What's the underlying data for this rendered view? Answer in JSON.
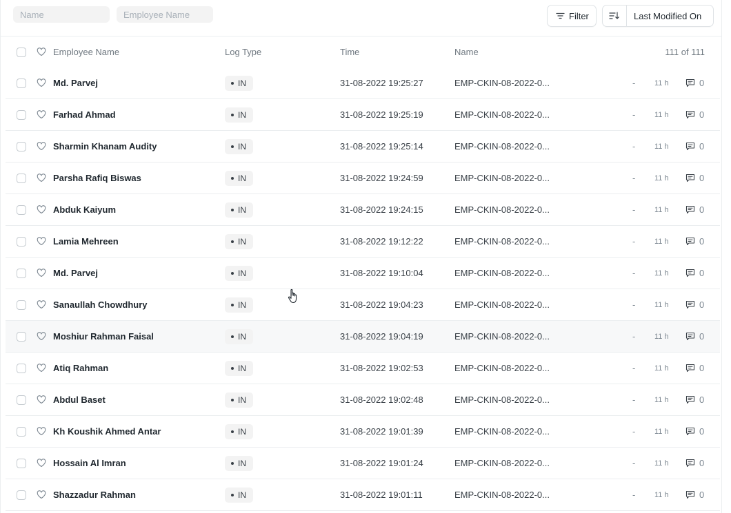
{
  "filters": {
    "name_placeholder": "Name",
    "employee_placeholder": "Employee Name",
    "filter_label": "Filter",
    "sort_label": "Last Modified On"
  },
  "columns": {
    "employee_name": "Employee Name",
    "log_type": "Log Type",
    "time": "Time",
    "name": "Name",
    "count": "111 of 111"
  },
  "rows": [
    {
      "employee": "Md. Parvej",
      "log_type": "IN",
      "time": "31-08-2022 19:25:27",
      "name": "EMP-CKIN-08-2022-0...",
      "dash": "-",
      "modified": "11 h",
      "comments": "0"
    },
    {
      "employee": "Farhad Ahmad",
      "log_type": "IN",
      "time": "31-08-2022 19:25:19",
      "name": "EMP-CKIN-08-2022-0...",
      "dash": "-",
      "modified": "11 h",
      "comments": "0"
    },
    {
      "employee": "Sharmin Khanam Audity",
      "log_type": "IN",
      "time": "31-08-2022 19:25:14",
      "name": "EMP-CKIN-08-2022-0...",
      "dash": "-",
      "modified": "11 h",
      "comments": "0"
    },
    {
      "employee": "Parsha Rafiq Biswas",
      "log_type": "IN",
      "time": "31-08-2022 19:24:59",
      "name": "EMP-CKIN-08-2022-0...",
      "dash": "-",
      "modified": "11 h",
      "comments": "0"
    },
    {
      "employee": "Abduk Kaiyum",
      "log_type": "IN",
      "time": "31-08-2022 19:24:15",
      "name": "EMP-CKIN-08-2022-0...",
      "dash": "-",
      "modified": "11 h",
      "comments": "0"
    },
    {
      "employee": "Lamia Mehreen",
      "log_type": "IN",
      "time": "31-08-2022 19:12:22",
      "name": "EMP-CKIN-08-2022-0...",
      "dash": "-",
      "modified": "11 h",
      "comments": "0"
    },
    {
      "employee": "Md. Parvej",
      "log_type": "IN",
      "time": "31-08-2022 19:10:04",
      "name": "EMP-CKIN-08-2022-0...",
      "dash": "-",
      "modified": "11 h",
      "comments": "0"
    },
    {
      "employee": "Sanaullah Chowdhury",
      "log_type": "IN",
      "time": "31-08-2022 19:04:23",
      "name": "EMP-CKIN-08-2022-0...",
      "dash": "-",
      "modified": "11 h",
      "comments": "0"
    },
    {
      "employee": "Moshiur Rahman Faisal",
      "log_type": "IN",
      "time": "31-08-2022 19:04:19",
      "name": "EMP-CKIN-08-2022-0...",
      "dash": "-",
      "modified": "11 h",
      "comments": "0"
    },
    {
      "employee": "Atiq Rahman",
      "log_type": "IN",
      "time": "31-08-2022 19:02:53",
      "name": "EMP-CKIN-08-2022-0...",
      "dash": "-",
      "modified": "11 h",
      "comments": "0"
    },
    {
      "employee": "Abdul Baset",
      "log_type": "IN",
      "time": "31-08-2022 19:02:48",
      "name": "EMP-CKIN-08-2022-0...",
      "dash": "-",
      "modified": "11 h",
      "comments": "0"
    },
    {
      "employee": "Kh Koushik Ahmed Antar",
      "log_type": "IN",
      "time": "31-08-2022 19:01:39",
      "name": "EMP-CKIN-08-2022-0...",
      "dash": "-",
      "modified": "11 h",
      "comments": "0"
    },
    {
      "employee": "Hossain Al Imran",
      "log_type": "IN",
      "time": "31-08-2022 19:01:24",
      "name": "EMP-CKIN-08-2022-0...",
      "dash": "-",
      "modified": "11 h",
      "comments": "0"
    },
    {
      "employee": "Shazzadur Rahman",
      "log_type": "IN",
      "time": "31-08-2022 19:01:11",
      "name": "EMP-CKIN-08-2022-0...",
      "dash": "-",
      "modified": "11 h",
      "comments": "0"
    }
  ],
  "hover_row_index": 8,
  "icons": {
    "filter": "filter-icon",
    "sort": "sort-descending-icon",
    "like": "heart-icon",
    "comment": "comment-icon",
    "cursor": "hand-pointer-icon"
  },
  "colors": {
    "border": "#ebeef0",
    "pill_bg": "#f3f3f3",
    "hover_row": "#f7f8f9",
    "text": "#1f272e",
    "muted": "#7c8791"
  }
}
